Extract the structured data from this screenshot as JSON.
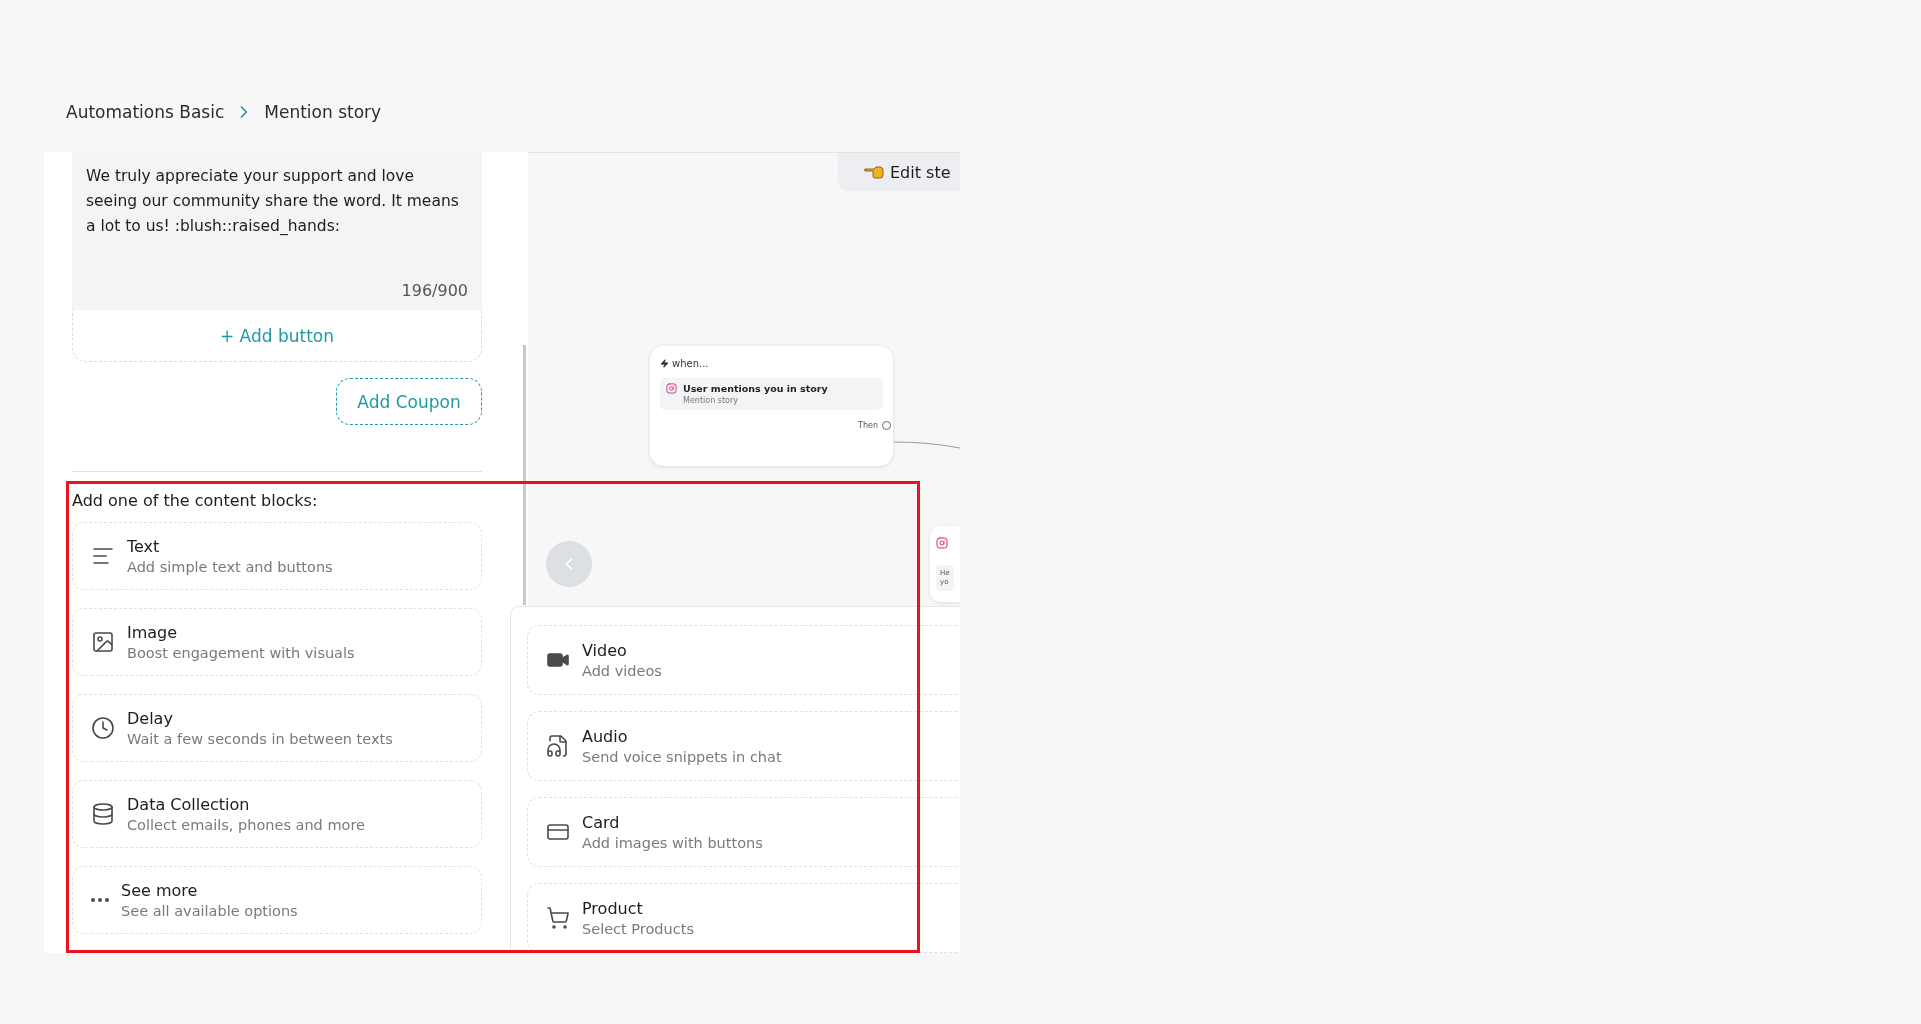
{
  "breadcrumbs": [
    {
      "label": "Automations Basic"
    },
    {
      "label": "Mention story"
    }
  ],
  "message": {
    "text": "We truly appreciate your support and love seeing our community share the word. It means a lot to us! :blush::raised_hands:",
    "counter": "196/900"
  },
  "add_button": "+ Add button",
  "add_coupon": "Add Coupon",
  "content_blocks": {
    "heading": "Add one of the content blocks:",
    "items": [
      {
        "kind": "text",
        "title": "Text",
        "subtitle": "Add simple text and buttons"
      },
      {
        "kind": "image",
        "title": "Image",
        "subtitle": "Boost engagement with visuals"
      },
      {
        "kind": "delay",
        "title": "Delay",
        "subtitle": "Wait a few seconds in between texts"
      },
      {
        "kind": "data",
        "title": "Data Collection",
        "subtitle": "Collect emails, phones and more"
      },
      {
        "kind": "more",
        "title": "See more",
        "subtitle": "See all available options"
      }
    ]
  },
  "canvas": {
    "edit_button": "Edit ste",
    "trigger_node": {
      "heading": "when...",
      "trigger": {
        "title": "User mentions you in story",
        "subtitle": "Mention story"
      },
      "output_label": "Then"
    },
    "next_node": {
      "lines": [
        "He",
        "yo"
      ]
    }
  },
  "more_blocks": {
    "items": [
      {
        "kind": "video",
        "title": "Video",
        "subtitle": "Add videos"
      },
      {
        "kind": "audio",
        "title": "Audio",
        "subtitle": "Send voice snippets in chat"
      },
      {
        "kind": "card",
        "title": "Card",
        "subtitle": "Add images with buttons"
      },
      {
        "kind": "product",
        "title": "Product",
        "subtitle": "Select Products"
      }
    ]
  }
}
